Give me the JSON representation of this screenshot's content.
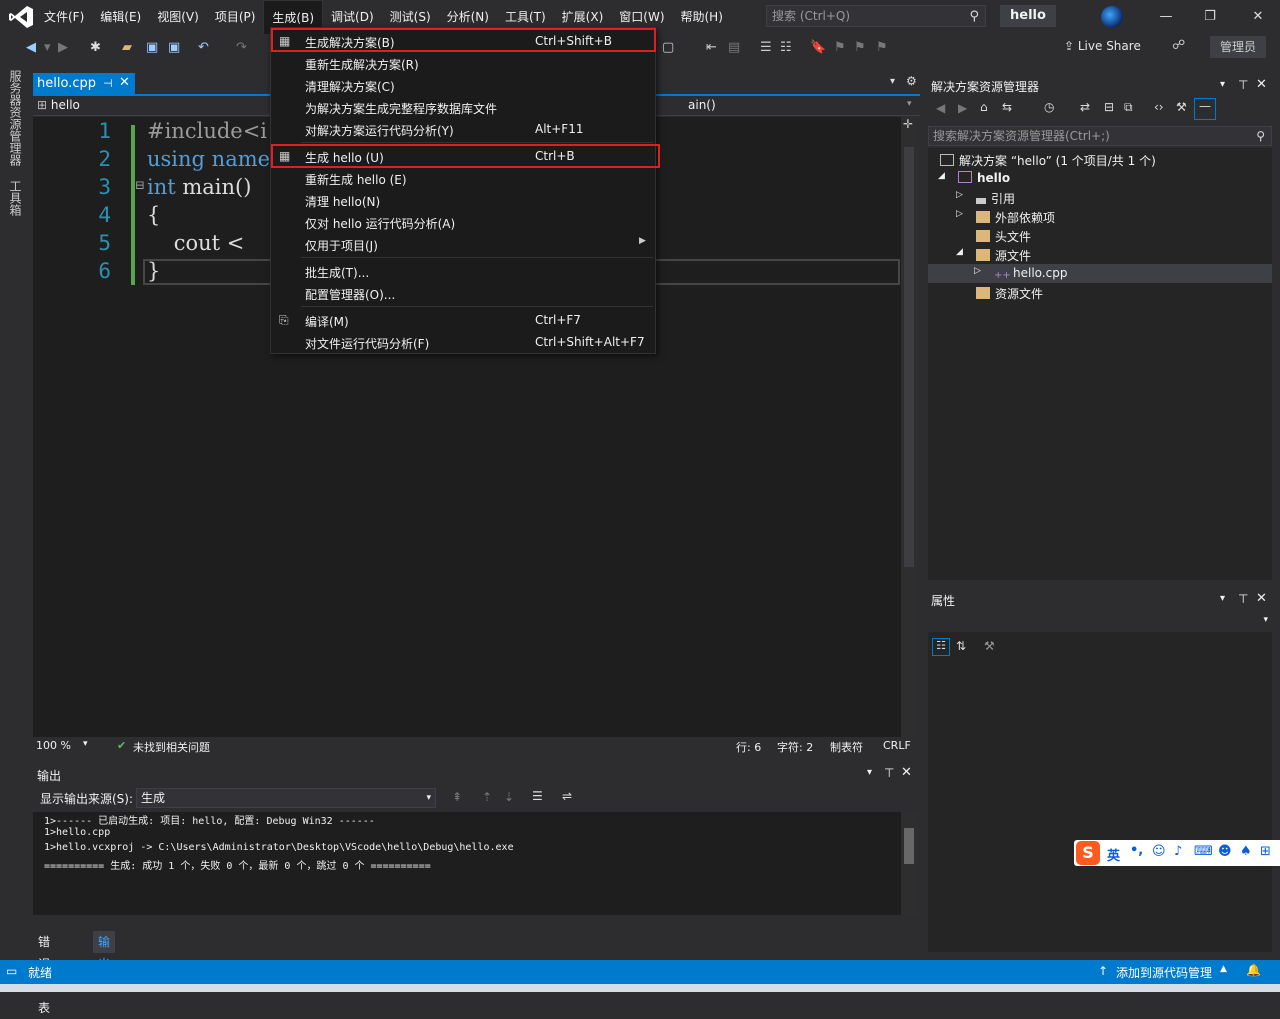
{
  "menubar": {
    "items": [
      "文件(F)",
      "编辑(E)",
      "视图(V)",
      "项目(P)",
      "生成(B)",
      "调试(D)",
      "测试(S)",
      "分析(N)",
      "工具(T)",
      "扩展(X)",
      "窗口(W)",
      "帮助(H)"
    ],
    "active_index": 4,
    "search_placeholder": "搜索 (Ctrl+Q)",
    "project_title": "hello"
  },
  "toolbar": {
    "live_share": "Live Share",
    "admin": "管理员"
  },
  "left_strip": {
    "server_explorer": "服务器资源管理器",
    "toolbox": "工具箱"
  },
  "editor": {
    "tab_label": "hello.cpp",
    "nav_scope": "hello",
    "nav_function": "ain()",
    "line_numbers": [
      "1",
      "2",
      "3",
      "4",
      "5",
      "6"
    ],
    "lines": [
      {
        "prefix": "",
        "keyword": "",
        "text": "#include<i"
      },
      {
        "prefix": "",
        "keyword": "using",
        "text": " name"
      },
      {
        "prefix": "⊟",
        "keyword": "int",
        "text": " main()"
      },
      {
        "prefix": "",
        "keyword": "",
        "text": "{"
      },
      {
        "prefix": "",
        "keyword": "",
        "text": "    cout <"
      },
      {
        "prefix": "",
        "keyword": "",
        "text": "}"
      }
    ],
    "zoom": "100 %",
    "issues": "未找到相关问题",
    "line": "行: 6",
    "char": "字符: 2",
    "tabs": "制表符",
    "eol": "CRLF"
  },
  "build_menu": {
    "items": [
      {
        "label": "生成解决方案(B)",
        "shortcut": "Ctrl+Shift+B",
        "icon": "build-solution-icon",
        "highlight": true
      },
      {
        "label": "重新生成解决方案(R)",
        "shortcut": ""
      },
      {
        "label": "清理解决方案(C)",
        "shortcut": ""
      },
      {
        "label": "为解决方案生成完整程序数据库文件",
        "shortcut": ""
      },
      {
        "label": "对解决方案运行代码分析(Y)",
        "shortcut": "Alt+F11"
      },
      {
        "label": "生成 hello (U)",
        "shortcut": "Ctrl+B",
        "icon": "build-project-icon",
        "highlight": true
      },
      {
        "label": "重新生成 hello (E)",
        "shortcut": ""
      },
      {
        "label": "清理 hello(N)",
        "shortcut": ""
      },
      {
        "label": "仅对 hello 运行代码分析(A)",
        "shortcut": ""
      },
      {
        "label": "仅用于项目(J)",
        "shortcut": "",
        "submenu": true
      },
      {
        "label": "批生成(T)...",
        "shortcut": ""
      },
      {
        "label": "配置管理器(O)...",
        "shortcut": ""
      },
      {
        "label": "编译(M)",
        "shortcut": "Ctrl+F7",
        "icon": "compile-icon"
      },
      {
        "label": "对文件运行代码分析(F)",
        "shortcut": "Ctrl+Shift+Alt+F7"
      }
    ]
  },
  "output": {
    "title": "输出",
    "source_label": "显示输出来源(S):",
    "source_value": "生成",
    "lines": [
      "1>------ 已启动生成: 项目: hello, 配置: Debug Win32 ------",
      "1>hello.cpp",
      "1>hello.vcxproj -> C:\\Users\\Administrator\\Desktop\\VScode\\hello\\Debug\\hello.exe",
      "========== 生成: 成功 1 个，失败 0 个，最新 0 个，跳过 0 个 =========="
    ],
    "tab_errors": "错误列表",
    "tab_output": "输出"
  },
  "solution_explorer": {
    "title": "解决方案资源管理器",
    "search_placeholder": "搜索解决方案资源管理器(Ctrl+;)",
    "solution": "解决方案 “hello” (1 个项目/共 1 个)",
    "project": "hello",
    "nodes": [
      "引用",
      "外部依赖项",
      "头文件",
      "源文件",
      "hello.cpp",
      "资源文件"
    ]
  },
  "properties": {
    "title": "属性"
  },
  "statusbar": {
    "ready": "就绪",
    "source_control": "添加到源代码管理"
  },
  "ime": {
    "mode": "英"
  },
  "colors": {
    "accent": "#007acc",
    "highlight_box": "#e02020",
    "keyword": "#569cd6",
    "line_number": "#2b91af"
  }
}
